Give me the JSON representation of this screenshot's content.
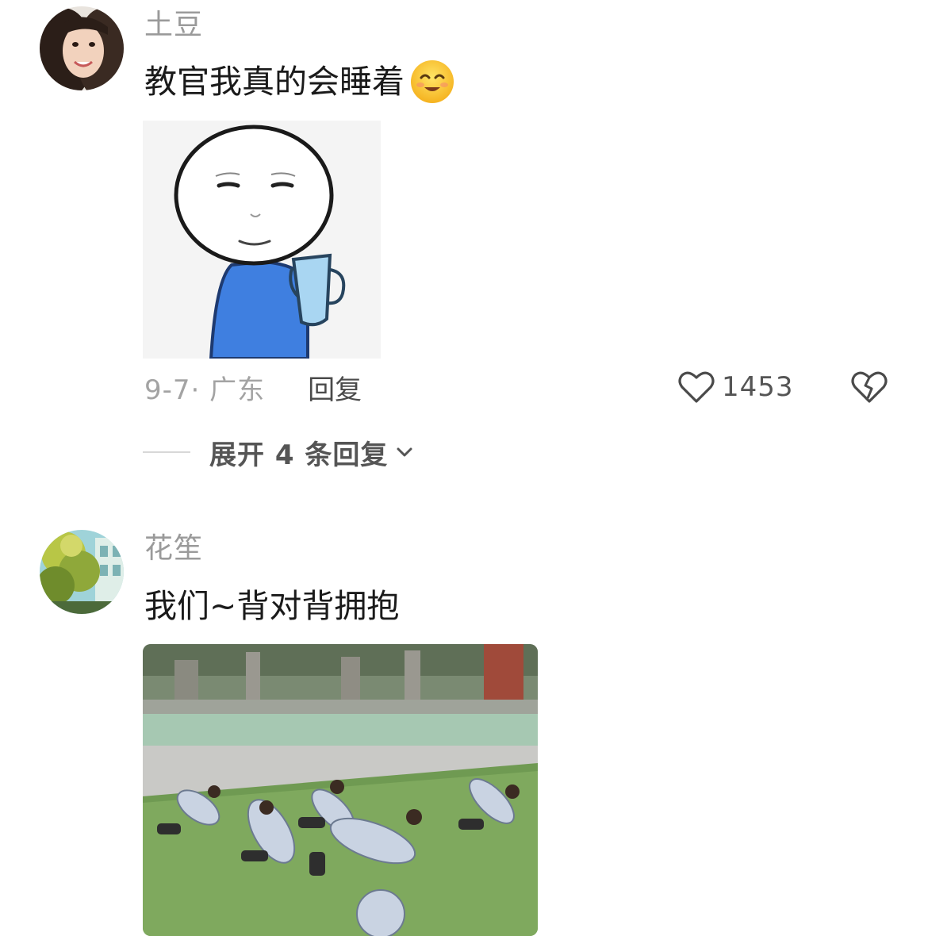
{
  "comments": [
    {
      "username": "土豆",
      "text": "教官我真的会睡着",
      "emoji": "smiling-face-emoji",
      "meta_date": "9-7· 广东",
      "reply_label": "回复",
      "like_count": "1453",
      "expand_label": "展开 4 条回复",
      "media": "sticker-blue-shirt-cup"
    },
    {
      "username": "花笙",
      "text": "我们~背对背拥抱",
      "media": "photo-students-lying-on-grass"
    }
  ],
  "icons": {
    "like": "heart-outline-icon",
    "dislike": "broken-heart-icon",
    "expand": "chevron-down-icon"
  }
}
